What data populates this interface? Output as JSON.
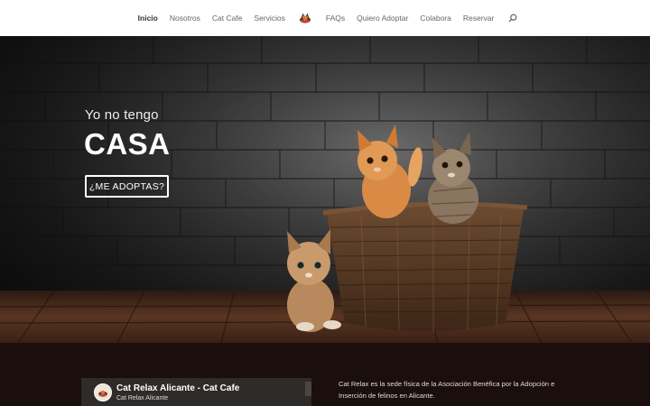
{
  "nav": {
    "items": [
      {
        "label": "Inicio",
        "active": true
      },
      {
        "label": "Nosotros"
      },
      {
        "label": "Cat Cafe"
      },
      {
        "label": "Servicios"
      },
      {
        "label": "FAQs"
      },
      {
        "label": "Quiero Adoptar"
      },
      {
        "label": "Colabora"
      },
      {
        "label": "Reservar"
      }
    ],
    "logo_icon": "cat-logo-icon",
    "search_icon": "search-icon"
  },
  "hero": {
    "subtitle": "Yo no tengo",
    "title": "CASA",
    "button_label": "¿ME ADOPTAS?"
  },
  "video": {
    "title": "Cat Relax Alicante - Cat Cafe",
    "channel": "Cat Relax Alicante"
  },
  "about": {
    "text": "Cat Relax es la sede física de la Asociación Benéfica por la Adopción e Inserción de felinos en Alicante."
  },
  "colors": {
    "nav_active": "#333333",
    "nav_text": "#666666",
    "bottom_bg": "#1a0f0c"
  }
}
